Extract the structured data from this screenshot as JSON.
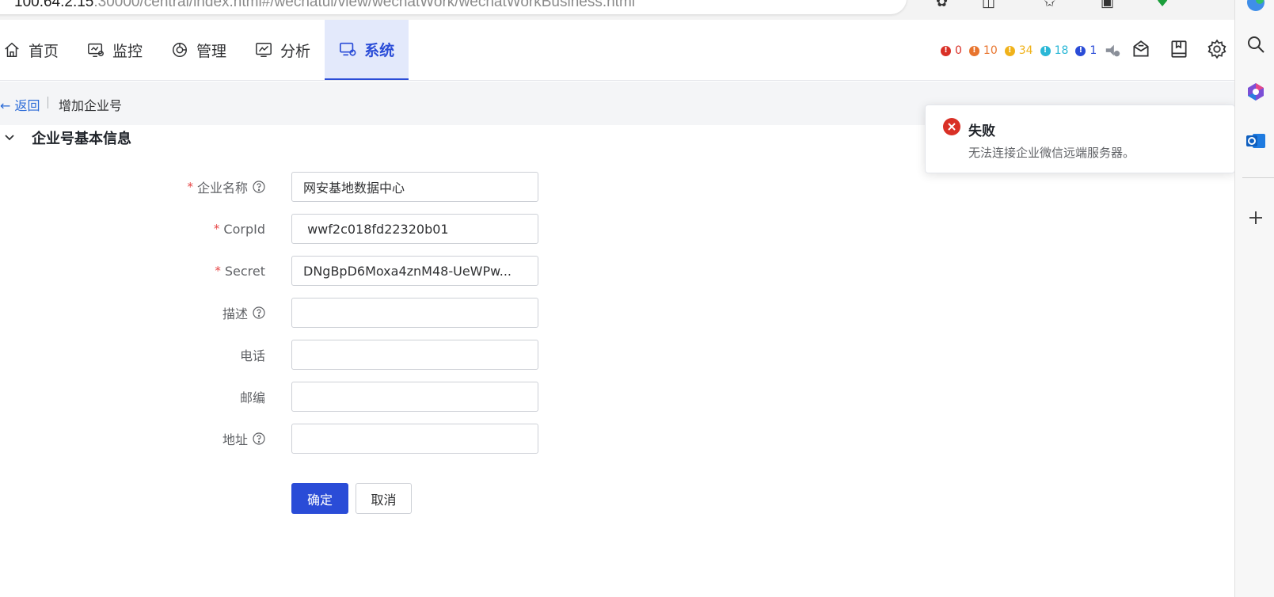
{
  "browser": {
    "url_host": "100.64.2.15",
    "url_port": ":30000",
    "url_path": "/central/index.html#/wechatui/view/wechatWork/wechatWorkBusiness.html"
  },
  "nav": {
    "items": [
      {
        "label": "首页",
        "icon": "home-icon"
      },
      {
        "label": "监控",
        "icon": "monitor-icon"
      },
      {
        "label": "管理",
        "icon": "manage-icon"
      },
      {
        "label": "分析",
        "icon": "analysis-icon"
      },
      {
        "label": "系统",
        "icon": "system-icon",
        "active": true
      }
    ]
  },
  "alerts": [
    {
      "count": "0",
      "color": "#d93026"
    },
    {
      "count": "10",
      "color": "#e8742d"
    },
    {
      "count": "34",
      "color": "#f0b21a"
    },
    {
      "count": "18",
      "color": "#2ab7d6"
    },
    {
      "count": "1",
      "color": "#2a4cd7"
    }
  ],
  "subbar": {
    "back_label": "返回",
    "page_title": "增加企业号"
  },
  "section": {
    "title": "企业号基本信息"
  },
  "form": {
    "fields": [
      {
        "label": "企业名称",
        "required": true,
        "help": true,
        "value": "网安基地数据中心"
      },
      {
        "label": "CorpId",
        "required": true,
        "help": false,
        "value": " wwf2c018fd22320b01"
      },
      {
        "label": "Secret",
        "required": true,
        "help": false,
        "value": "DNgBpD6Moxa4znM48-UeWPw..."
      },
      {
        "label": "描述",
        "required": false,
        "help": true,
        "value": ""
      },
      {
        "label": "电话",
        "required": false,
        "help": false,
        "value": ""
      },
      {
        "label": "邮编",
        "required": false,
        "help": false,
        "value": ""
      },
      {
        "label": "地址",
        "required": false,
        "help": true,
        "value": ""
      }
    ],
    "confirm_label": "确定",
    "cancel_label": "取消"
  },
  "notification": {
    "title": "失败",
    "message": "无法连接企业微信远端服务器。",
    "type": "error"
  },
  "colors": {
    "primary": "#2a4cd7",
    "error": "#d93026",
    "required": "#e64545"
  }
}
